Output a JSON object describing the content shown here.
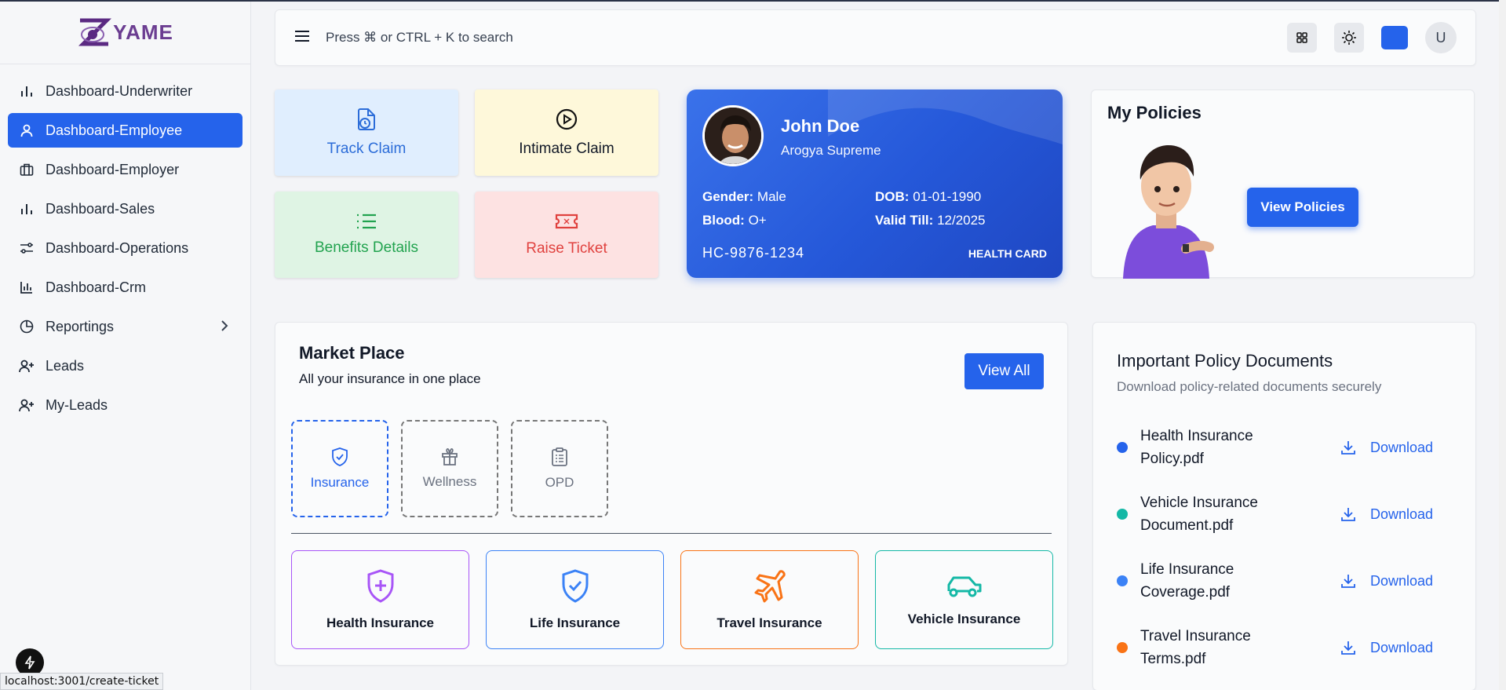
{
  "brand": {
    "logo_text": "YAME",
    "logo_letter": "Z"
  },
  "sidebar": {
    "items": [
      {
        "label": "Dashboard-Underwriter",
        "icon": "bar-chart-icon"
      },
      {
        "label": "Dashboard-Employee",
        "icon": "user-icon",
        "active": true
      },
      {
        "label": "Dashboard-Employer",
        "icon": "briefcase-icon"
      },
      {
        "label": "Dashboard-Sales",
        "icon": "bar-chart-icon"
      },
      {
        "label": "Dashboard-Operations",
        "icon": "sliders-icon"
      },
      {
        "label": "Dashboard-Crm",
        "icon": "bar-chart-icon"
      },
      {
        "label": "Reportings",
        "icon": "pie-chart-icon"
      },
      {
        "label": "Leads",
        "icon": "user-plus-icon"
      },
      {
        "label": "My-Leads",
        "icon": "user-plus-icon"
      }
    ]
  },
  "topbar": {
    "search_hint": "Press ⌘ or CTRL + K to search",
    "avatar_letter": "U"
  },
  "quick_actions": {
    "track": "Track Claim",
    "intimate": "Intimate Claim",
    "benefits": "Benefits Details",
    "raise": "Raise Ticket"
  },
  "health_card": {
    "name": "John Doe",
    "plan": "Arogya Supreme",
    "gender_label": "Gender:",
    "gender": "Male",
    "dob_label": "DOB:",
    "dob": "01-01-1990",
    "blood_label": "Blood:",
    "blood": "O+",
    "valid_label": "Valid Till:",
    "valid": "12/2025",
    "id": "HC-9876-1234",
    "card_label": "HEALTH CARD"
  },
  "policies": {
    "title": "My Policies",
    "button": "View Policies"
  },
  "market": {
    "title": "Market Place",
    "subtitle": "All your insurance in one place",
    "view_all": "View All",
    "categories": [
      "Insurance",
      "Wellness",
      "OPD"
    ],
    "products": [
      "Health Insurance",
      "Life Insurance",
      "Travel Insurance",
      "Vehicle Insurance"
    ]
  },
  "docs": {
    "title": "Important Policy Documents",
    "subtitle": "Download policy-related documents securely",
    "items": [
      {
        "name": "Health Insurance Policy.pdf",
        "color": "#2563eb"
      },
      {
        "name": "Vehicle Insurance Document.pdf",
        "color": "#14b8a6"
      },
      {
        "name": "Life Insurance Coverage.pdf",
        "color": "#3b82f6"
      },
      {
        "name": "Travel Insurance Terms.pdf",
        "color": "#f97316"
      }
    ],
    "download_label": "Download"
  },
  "status_bar": "localhost:3001/create-ticket",
  "colors": {
    "accent": "#2563eb"
  }
}
